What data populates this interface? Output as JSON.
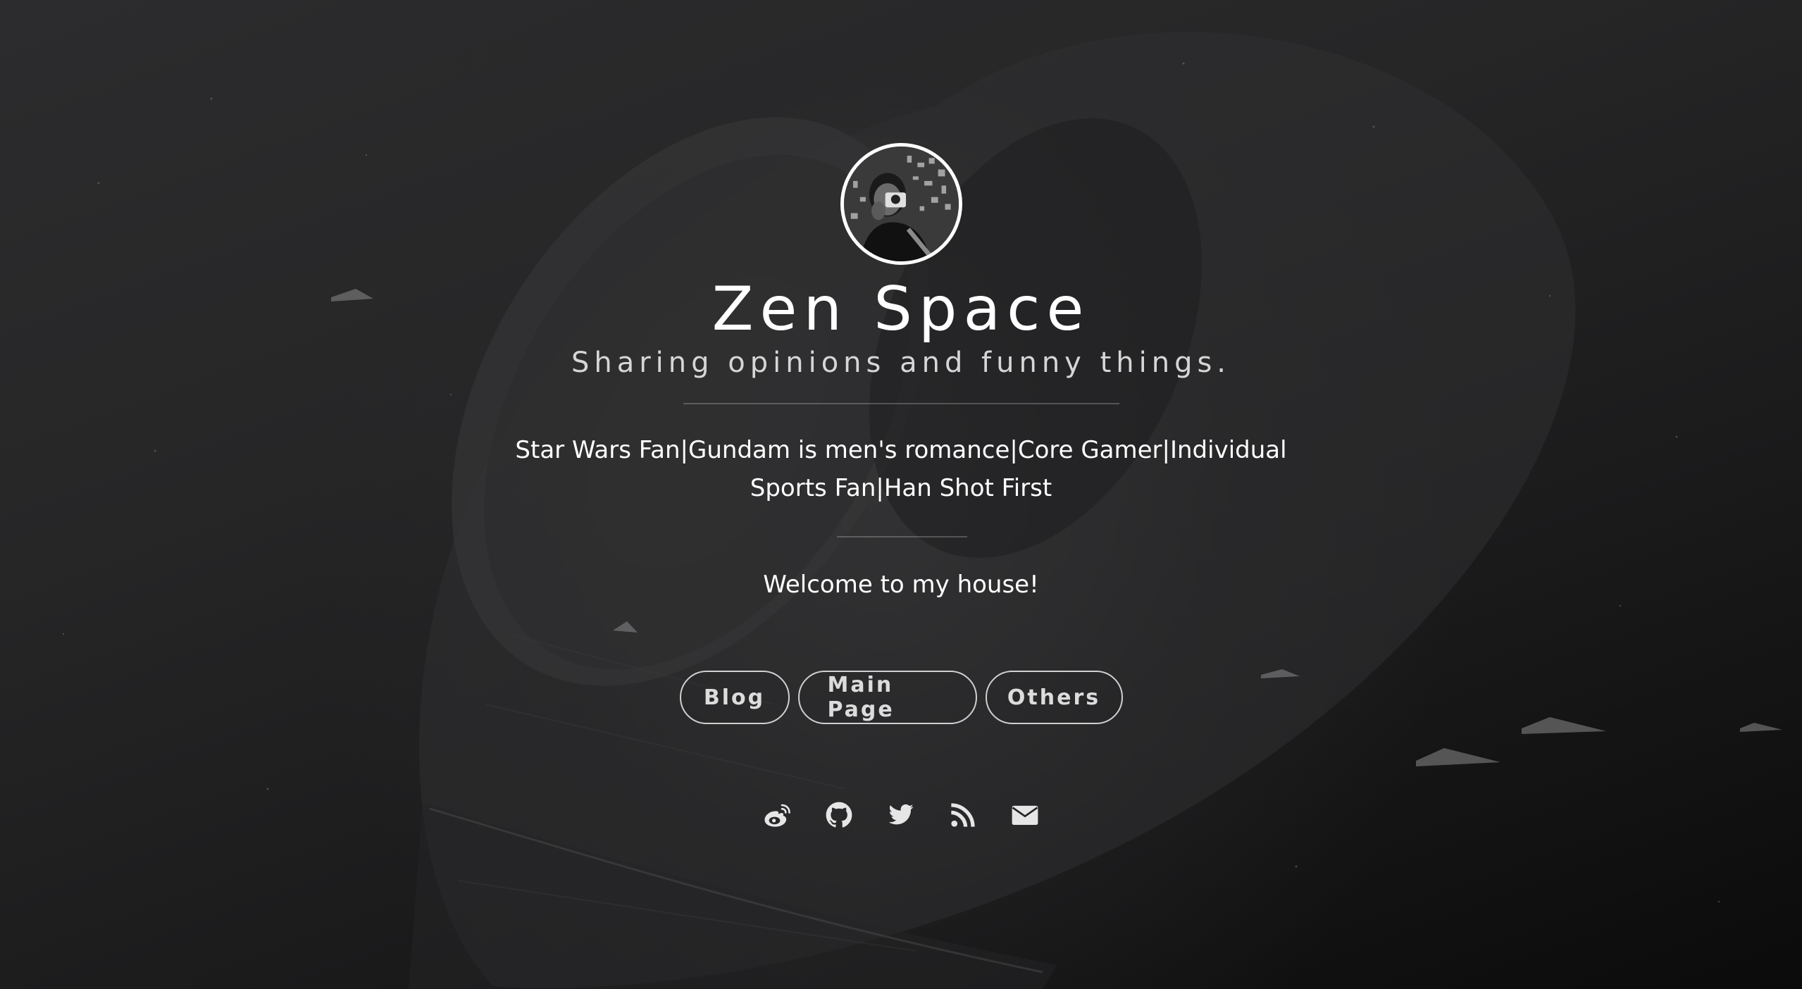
{
  "site": {
    "title": "Zen Space",
    "subtitle": "Sharing opinions and funny things.",
    "bio": "Star Wars Fan|Gundam is men's romance|Core Gamer|Individual Sports Fan|Han Shot First",
    "welcome": "Welcome to my house!"
  },
  "nav": {
    "blog_label": "Blog",
    "main_label": "Main Page",
    "others_label": "Others"
  },
  "social": [
    {
      "icon": "weibo-icon"
    },
    {
      "icon": "github-icon"
    },
    {
      "icon": "twitter-icon"
    },
    {
      "icon": "rss-icon"
    },
    {
      "icon": "envelope-icon"
    }
  ],
  "colors": {
    "background": "#1e1e1f",
    "text": "#ffffff",
    "subtitle": "#d6d6d6",
    "button_border": "#d0d0d0",
    "icon": "#e6e6e6"
  }
}
